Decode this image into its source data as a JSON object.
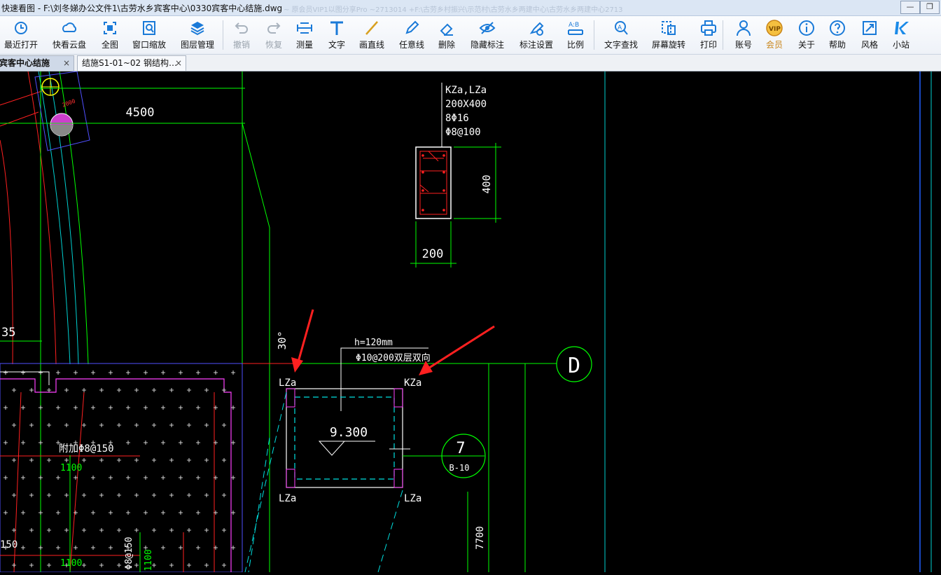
{
  "window": {
    "title": "快速看图 - F:\\刘冬娣办公文件1\\古劳水乡宾客中心\\0330宾客中心结施.dwg",
    "faded_text": "~ 原会员VIP1以图分享Pro ~2713014   +F:\\古劳乡村振兴\\示范村\\古劳水乡两建中心\\古劳水乡两建中心2713"
  },
  "toolbar": [
    {
      "label": "最近打开",
      "icon": "clock-icon"
    },
    {
      "label": "快看云盘",
      "icon": "cloud-icon"
    },
    {
      "label": "全图",
      "icon": "fullview-icon"
    },
    {
      "label": "窗口缩放",
      "icon": "zoom-window-icon"
    },
    {
      "label": "图层管理",
      "icon": "layers-icon"
    },
    {
      "label": "撤销",
      "icon": "undo-icon"
    },
    {
      "label": "恢复",
      "icon": "redo-icon"
    },
    {
      "label": "测量",
      "icon": "ruler-icon"
    },
    {
      "label": "文字",
      "icon": "text-icon"
    },
    {
      "label": "画直线",
      "icon": "line-icon"
    },
    {
      "label": "任意线",
      "icon": "pencil-icon"
    },
    {
      "label": "删除",
      "icon": "eraser-icon"
    },
    {
      "label": "隐藏标注",
      "icon": "eye-hide-icon"
    },
    {
      "label": "标注设置",
      "icon": "annotation-settings-icon"
    },
    {
      "label": "比例",
      "icon": "scale-icon"
    },
    {
      "label": "文字查找",
      "icon": "text-search-icon"
    },
    {
      "label": "屏幕旋转",
      "icon": "rotate-screen-icon"
    },
    {
      "label": "打印",
      "icon": "printer-icon"
    },
    {
      "label": "账号",
      "icon": "user-icon"
    },
    {
      "label": "会员",
      "icon": "vip-icon"
    },
    {
      "label": "关于",
      "icon": "info-icon"
    },
    {
      "label": "帮助",
      "icon": "help-icon"
    },
    {
      "label": "风格",
      "icon": "style-icon"
    },
    {
      "label": "小站",
      "icon": "k-logo-icon"
    }
  ],
  "tabs": [
    {
      "label": "宾客中心结施",
      "close": "×"
    },
    {
      "label": "结施S1-01~02 钢结构…",
      "close": "×"
    }
  ],
  "drawing": {
    "dim_4500": "4500",
    "col_label": "KZa,LZa",
    "col_size": "200X400",
    "col_bars": "8Φ16",
    "col_stirrup": "Φ8@100",
    "dim_400": "400",
    "dim_200": "200",
    "dim_35": "35",
    "angle_30": "30°",
    "slab_h": "h=120mm",
    "slab_bars": "Φ10@200双层双向",
    "lza_tl": "LZa",
    "kza_tr": "KZa",
    "lza_bl": "LZa",
    "lza_br": "LZa",
    "elev": "9.300",
    "grid_d": "D",
    "grid_7": "7",
    "grid_7_sub": "B-10",
    "rebar_150": "附加Φ8@150",
    "dim_1100a": "1100",
    "dim_150": "150",
    "dim_1100b": "1100",
    "rebar_150v": "Φ8@150",
    "dim_1100c": "1100",
    "dim_7700": "7700",
    "red_small": "2000"
  }
}
